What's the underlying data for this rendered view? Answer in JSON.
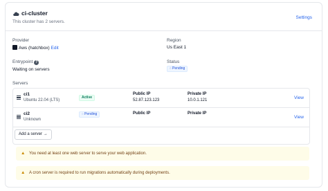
{
  "header": {
    "cluster_name": "ci-cluster",
    "subtitle": "This cluster has 2 servers.",
    "settings_label": "Settings"
  },
  "details": {
    "provider_label": "Provider",
    "provider_value": "Aws (hatchbox)",
    "provider_edit": "Edit",
    "region_label": "Region",
    "region_value": "Us East 1",
    "entrypoint_label": "Entrypoint",
    "entrypoint_value": "Waiting on servers",
    "status_label": "Status",
    "status_value": "Pending"
  },
  "servers": {
    "label": "Servers",
    "public_ip_label": "Public IP",
    "private_ip_label": "Private IP",
    "view_label": "View",
    "rows": [
      {
        "name": "ci1",
        "os": "Ubuntu 22.04 (LTS)",
        "status": "Active",
        "public_ip": "52.87.123.123",
        "private_ip": "10.0.1.121"
      },
      {
        "name": "ci2",
        "os": "Unknown",
        "status": "Pending",
        "public_ip": "",
        "private_ip": ""
      }
    ],
    "add_button": "Add a server →"
  },
  "warnings": [
    "You need at least one web server to serve your web application.",
    "A cron server is required to run migrations automatically during deployments."
  ],
  "icons": {
    "cluster": "cloud-icon",
    "provider": "aws-icon",
    "help": "question-circle-icon",
    "server": "server-icon",
    "pending": "spinner-icon",
    "warning": "warning-triangle-icon"
  },
  "colors": {
    "link": "#2563eb",
    "active_bg": "#ecfdf5",
    "active_text": "#047857",
    "pending_bg": "#eff6ff",
    "pending_text": "#1d4ed8",
    "warning_bg": "#fefce8",
    "warning_icon": "#ca8a04"
  }
}
